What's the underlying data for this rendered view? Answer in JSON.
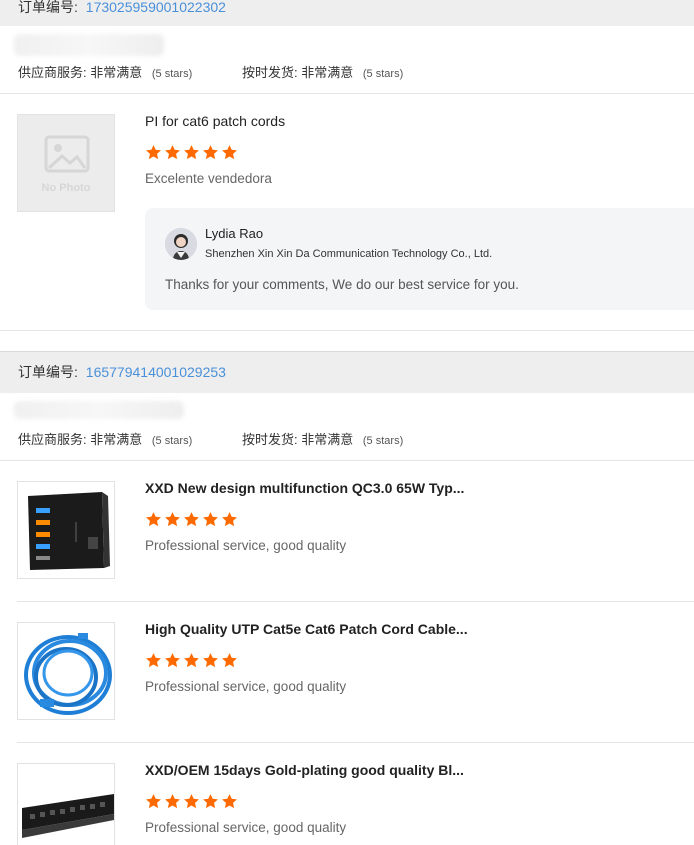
{
  "orders": [
    {
      "label": "订单编号:",
      "number": "173025959001022302",
      "supplier_service_label": "供应商服务:",
      "supplier_service_value": "非常满意",
      "supplier_service_stars": "(5 stars)",
      "ontime_label": "按时发货:",
      "ontime_value": "非常满意",
      "ontime_stars": "(5 stars)",
      "items": [
        {
          "title": "PI for cat6 patch cords",
          "rating": 5,
          "comment": "Excelente vendedora",
          "thumb_text": "No Photo",
          "reply": {
            "name": "Lydia Rao",
            "company": "Shenzhen Xin Xin Da Communication Technology Co., Ltd.",
            "text": "Thanks for your comments, We do our best service for you."
          }
        }
      ]
    },
    {
      "label": "订单编号:",
      "number": "165779414001029253",
      "supplier_service_label": "供应商服务:",
      "supplier_service_value": "非常满意",
      "supplier_service_stars": "(5 stars)",
      "ontime_label": "按时发货:",
      "ontime_value": "非常满意",
      "ontime_stars": "(5 stars)",
      "items": [
        {
          "title": "XXD New design multifunction QC3.0 65W Typ...",
          "rating": 5,
          "comment": "Professional service, good quality"
        },
        {
          "title": "High Quality UTP Cat5e Cat6 Patch Cord Cable...",
          "rating": 5,
          "comment": "Professional service, good quality"
        },
        {
          "title": "XXD/OEM 15days Gold-plating good quality Bl...",
          "rating": 5,
          "comment": "Professional service, good quality"
        }
      ]
    }
  ],
  "colors": {
    "star": "#ff6a00",
    "link": "#4a90d9",
    "header_bg": "#eeeeee"
  }
}
